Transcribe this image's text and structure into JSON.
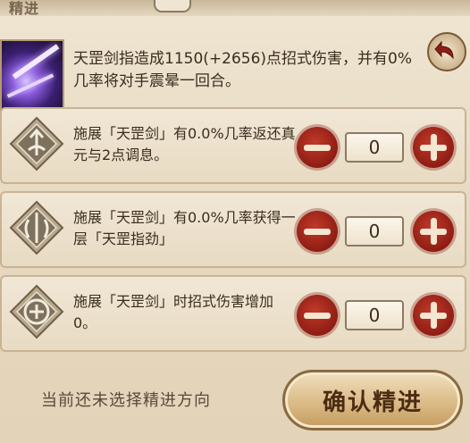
{
  "top": {
    "title": "精进"
  },
  "skill": {
    "description": "天罡剑指造成1150(+2656)点招式伤害，并有0%几率将对手震晕一回合。"
  },
  "rows": [
    {
      "text": "施展「天罡剑」有0.0%几率返还真元与2点调息。",
      "value": "0"
    },
    {
      "text": "施展「天罡剑」有0.0%几率获得一层「天罡指劲」",
      "value": "0"
    },
    {
      "text": "施展「天罡剑」时招式伤害增加0。",
      "value": "0"
    }
  ],
  "footer": {
    "status": "当前还未选择精进方向",
    "confirm_label": "确认精进"
  },
  "colors": {
    "accent_red": "#8e1d14",
    "panel_bg": "#efe5d2",
    "border_brown": "#8c7a62"
  }
}
